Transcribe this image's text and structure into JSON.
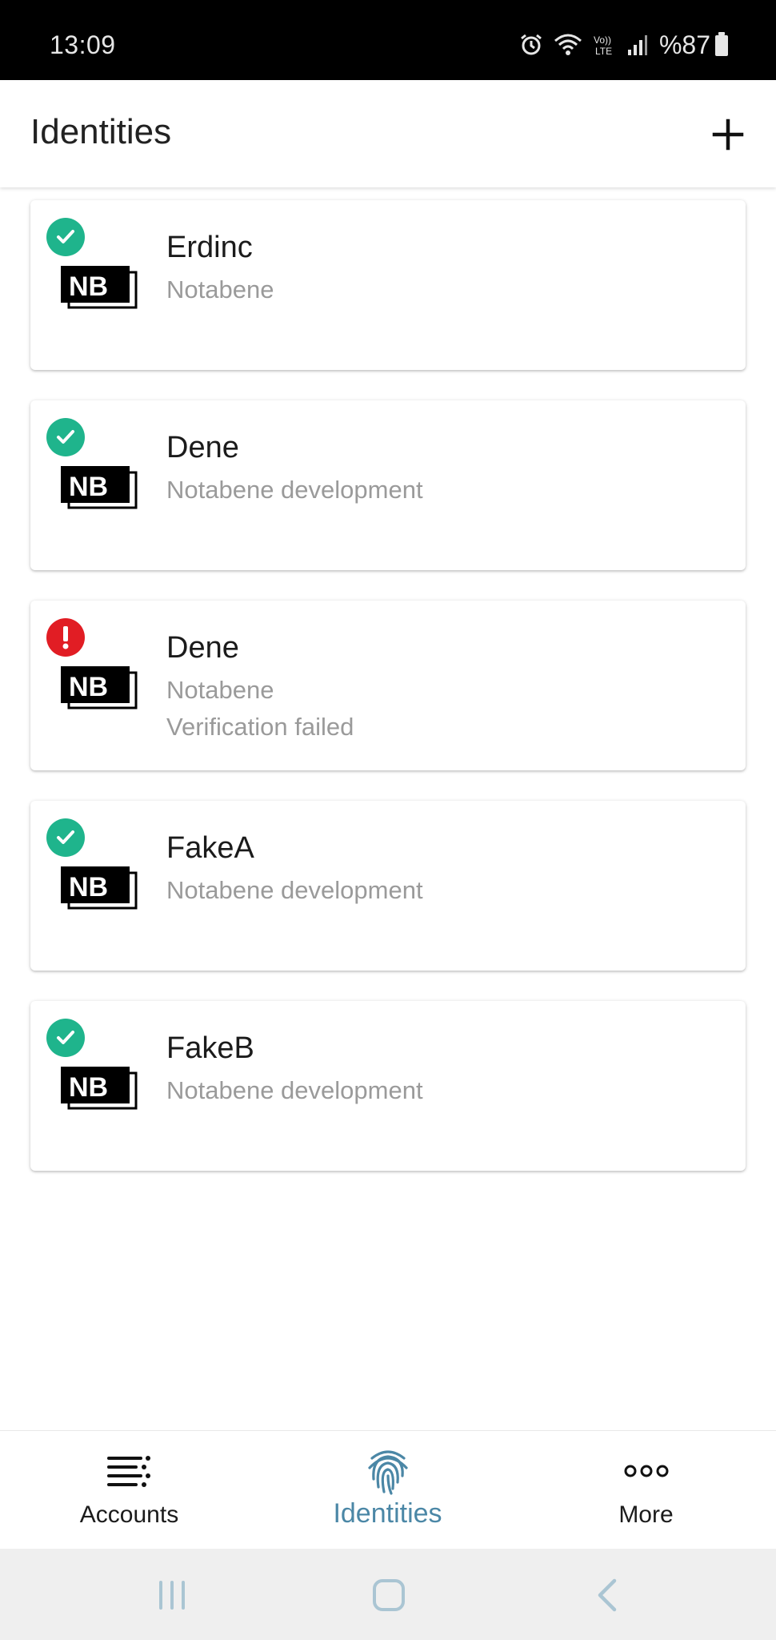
{
  "status_bar": {
    "time": "13:09",
    "battery": "%87",
    "icons": [
      "alarm-icon",
      "wifi-icon",
      "volte-icon",
      "signal-icon",
      "battery-icon"
    ]
  },
  "header": {
    "title": "Identities",
    "add_icon": "plus-icon"
  },
  "identities": [
    {
      "name": "Erdinc",
      "org": "Notabene",
      "note": "",
      "status": "verified"
    },
    {
      "name": "Dene",
      "org": "Notabene development",
      "note": "",
      "status": "verified"
    },
    {
      "name": "Dene",
      "org": "Notabene",
      "note": "Verification failed",
      "status": "failed"
    },
    {
      "name": "FakeA",
      "org": "Notabene development",
      "note": "",
      "status": "verified"
    },
    {
      "name": "FakeB",
      "org": "Notabene development",
      "note": "",
      "status": "verified"
    }
  ],
  "logo_text": "NB",
  "colors": {
    "verified": "#1fb48c",
    "failed": "#e11d24",
    "active_nav": "#4b87a6"
  },
  "bottom_nav": {
    "accounts": "Accounts",
    "identities": "Identities",
    "more": "More",
    "active": "identities"
  },
  "system_nav": [
    "recent-apps-icon",
    "home-icon",
    "back-icon"
  ]
}
